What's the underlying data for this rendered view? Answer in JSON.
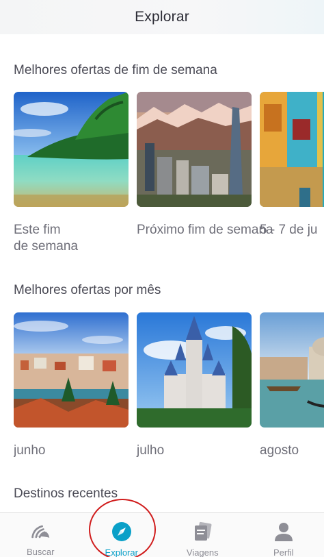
{
  "header": {
    "title": "Explorar"
  },
  "sections": {
    "weekend": {
      "title": "Melhores ofertas de fim de semana",
      "cards": [
        {
          "label": "Este fim\nde semana",
          "image": "tropical-beach"
        },
        {
          "label": "Próximo fim\nde semana",
          "image": "city-mountains"
        },
        {
          "label": "5 - 7 de ju",
          "image": "colorful-houses"
        }
      ]
    },
    "months": {
      "title": "Melhores ofertas por mês",
      "cards": [
        {
          "label": "junho",
          "image": "riverside-city"
        },
        {
          "label": "julho",
          "image": "fairytale-castle"
        },
        {
          "label": "agosto",
          "image": "venice-canal"
        }
      ]
    },
    "recent": {
      "title": "Destinos recentes"
    }
  },
  "tabs": [
    {
      "label": "Buscar",
      "icon": "skyscanner-icon",
      "active": false
    },
    {
      "label": "Explorar",
      "icon": "compass-icon",
      "active": true
    },
    {
      "label": "Viagens",
      "icon": "cards-icon",
      "active": false
    },
    {
      "label": "Perfil",
      "icon": "person-icon",
      "active": false
    }
  ],
  "colors": {
    "accent": "#0aa0c8",
    "annotation": "#d01c1c"
  }
}
